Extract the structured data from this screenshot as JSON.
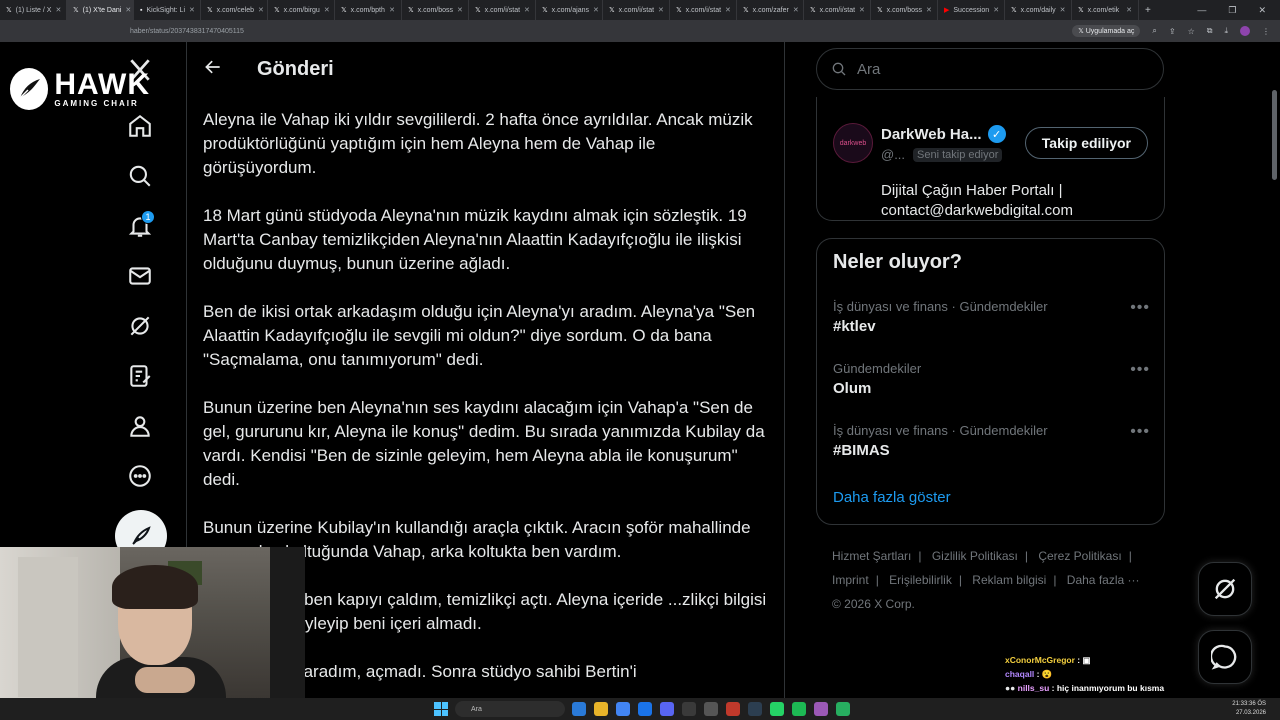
{
  "browser": {
    "tabs": [
      {
        "label": "(1) Liste / X",
        "active": false
      },
      {
        "label": "(1) X'te Dani",
        "active": true
      },
      {
        "label": "KickSight: Li",
        "active": false
      },
      {
        "label": "x.com/celeb",
        "active": false
      },
      {
        "label": "x.com/birgu",
        "active": false
      },
      {
        "label": "x.com/bpth",
        "active": false
      },
      {
        "label": "x.com/boss",
        "active": false
      },
      {
        "label": "x.com/i/stat",
        "active": false
      },
      {
        "label": "x.com/ajans",
        "active": false
      },
      {
        "label": "x.com/i/stat",
        "active": false
      },
      {
        "label": "x.com/i/stat",
        "active": false
      },
      {
        "label": "x.com/zafer",
        "active": false
      },
      {
        "label": "x.com/i/stat",
        "active": false
      },
      {
        "label": "x.com/boss",
        "active": false
      },
      {
        "label": "Succession",
        "active": false
      },
      {
        "label": "x.com/daily",
        "active": false
      },
      {
        "label": "x.com/etik",
        "active": false
      }
    ],
    "url": "haber/status/2037438317470405115",
    "app_open_label": "Uygulamada aç"
  },
  "overlay_logo": {
    "main": "HAWK",
    "sub": "GAMING CHAIR"
  },
  "nav": {
    "notifications_badge": "1"
  },
  "main": {
    "header_title": "Gönderi",
    "paragraphs": [
      "Aleyna ile Vahap iki yıldır sevgililerdi. 2 hafta önce ayrıldılar. Ancak müzik prodüktörlüğünü yaptığım için hem Aleyna hem de Vahap ile görüşüyordum.",
      "18 Mart günü stüdyoda Aleyna'nın müzik kaydını almak için sözleştik. 19 Mart'ta Canbay temizlikçiden Aleyna'nın Alaattin Kadayıfçıoğlu ile ilişkisi olduğunu duymuş, bunun üzerine ağladı.",
      "Ben de ikisi ortak arkadaşım olduğu için Aleyna'yı aradım. Aleyna'ya \"Sen Alaattin Kadayıfçıoğlu ile sevgili mi oldun?\" diye sordum. O da bana \"Saçmalama, onu tanımıyorum\" dedi.",
      "Bunun üzerine ben Aleyna'nın ses kaydını alacağım için Vahap'a \"Sen de gel, gururunu kır, Aleyna ile konuş\" dedim. Bu sırada yanımızda Kubilay da vardı. Kendisi \"Ben de sizinle geleyim, hem Aleyna abla ile konuşurum\" dedi.",
      "Bunun üzerine Kubilay'ın kullandığı araçla çıktık. Aracın şoför mahallinde ...un yolcu koltuğunda Vahap, arka koltukta ben vardım.",
      "...üne geldik, ben kapıyı çaldım, temizlikçi açtı. Aleyna içeride ...zlikçi bilgisi olmadığını söyleyip beni içeri almadı.",
      "...e Aleyna'yı aradım, açmadı. Sonra stüdyo sahibi Bertin'i"
    ]
  },
  "right": {
    "search_placeholder": "Ara",
    "who": {
      "avatar_text": "darkweb",
      "name": "DarkWeb Ha...",
      "handle": "@...",
      "follows_you": "Seni takip ediyor",
      "follow_button": "Takip ediliyor",
      "bio_line1": "Dijital Çağın Haber Portalı |",
      "bio_line2": "contact@darkwebdigital.com"
    },
    "trends": {
      "title": "Neler oluyor?",
      "items": [
        {
          "meta": "İş dünyası ve finans · Gündemdekiler",
          "name": "#ktlev"
        },
        {
          "meta": "Gündemdekiler",
          "name": "Olum"
        },
        {
          "meta": "İş dünyası ve finans · Gündemdekiler",
          "name": "#BIMAS"
        }
      ],
      "show_more": "Daha fazla göster"
    },
    "footer": {
      "links": [
        "Hizmet Şartları",
        "Gizlilik Politikası",
        "Çerez Politikası",
        "Imprint",
        "Erişilebilirlik",
        "Reklam bilgisi",
        "Daha fazla ···"
      ],
      "copyright": "© 2026 X Corp."
    }
  },
  "chat": [
    {
      "user": "xConorMcGregor",
      "sep": " : ",
      "msg": "▣"
    },
    {
      "user": "chaqall",
      "sep": " : ",
      "msg": "😮"
    },
    {
      "user": "nills_su",
      "sep": " : ",
      "msg": "hiç inanmıyorum bu kısma"
    }
  ],
  "taskbar": {
    "search_label": "Ara",
    "time": "21:33:36 ÖS",
    "date": "27.03.2026"
  },
  "colors": {
    "accent": "#1d9bf0",
    "background": "#000000",
    "border": "#2f3336",
    "muted": "#71767b"
  }
}
